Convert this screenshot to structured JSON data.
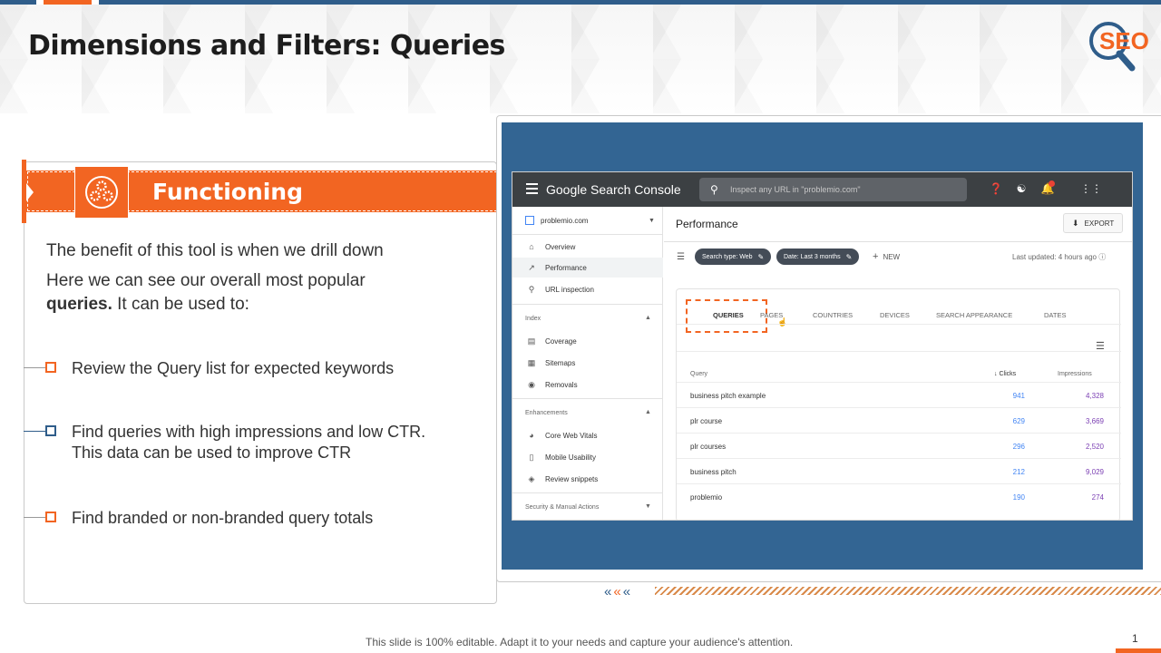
{
  "slide": {
    "title": "Dimensions and Filters: Queries",
    "logo_text": "SEO",
    "footer": "This slide is 100% editable. Adapt it to your needs and capture your audience's attention.",
    "page_number": "1",
    "colors": {
      "accent": "#f26522",
      "navy": "#2f5d8a",
      "panel": "#336593"
    }
  },
  "functioning": {
    "label": "Functioning",
    "icon": "gears-icon"
  },
  "body": {
    "line1": "The benefit of this tool is when we drill down",
    "line2a": "Here we can see our overall most popular",
    "line2b_bold": "queries.",
    "line2c": " It can be used to:"
  },
  "bullets": [
    {
      "text": "Review the Query list for expected keywords"
    },
    {
      "text": "Find queries with high impressions and low CTR. This data can be used to improve CTR"
    },
    {
      "text": "Find branded or non-branded query totals"
    }
  ],
  "gsc": {
    "brand": "Google Search Console",
    "search_placeholder": "Inspect any URL in \"problemio.com\"",
    "property": "problemio.com",
    "nav": {
      "overview": "Overview",
      "performance": "Performance",
      "url_inspection": "URL inspection",
      "index_section": "Index",
      "coverage": "Coverage",
      "sitemaps": "Sitemaps",
      "removals": "Removals",
      "enhancements_section": "Enhancements",
      "core_web_vitals": "Core Web Vitals",
      "mobile_usability": "Mobile Usability",
      "review_snippets": "Review snippets",
      "security_section": "Security & Manual Actions"
    },
    "page_title": "Performance",
    "export_label": "EXPORT",
    "chip_search_type": "Search type: Web",
    "chip_date": "Date: Last 3 months",
    "new_label": "NEW",
    "last_updated": "Last updated: 4 hours ago",
    "notification_count": "8",
    "tabs": [
      "QUERIES",
      "PAGES",
      "COUNTRIES",
      "DEVICES",
      "SEARCH APPEARANCE",
      "DATES"
    ],
    "columns": {
      "query": "Query",
      "clicks": "Clicks",
      "impressions": "Impressions"
    },
    "rows": [
      {
        "query": "business pitch example",
        "clicks": "941",
        "impressions": "4,328"
      },
      {
        "query": "plr course",
        "clicks": "629",
        "impressions": "3,669"
      },
      {
        "query": "plr courses",
        "clicks": "296",
        "impressions": "2,520"
      },
      {
        "query": "business pitch",
        "clicks": "212",
        "impressions": "9,029"
      },
      {
        "query": "problemio",
        "clicks": "190",
        "impressions": "274"
      }
    ]
  }
}
